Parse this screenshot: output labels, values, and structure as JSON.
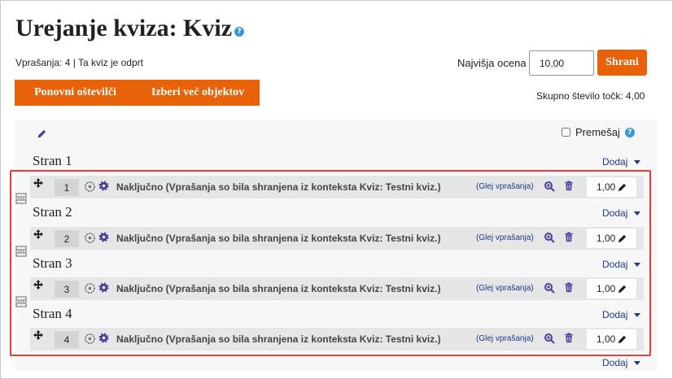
{
  "header": {
    "title": "Urejanje kviza: Kviz",
    "info": "Vprašanja: 4 | Ta kviz je odprt"
  },
  "grade": {
    "label": "Najvišja ocena",
    "value": "10,00",
    "save_label": "Shrani",
    "total_label": "Skupno število točk: 4,00"
  },
  "actions": {
    "repaginate": "Ponovni oštevilči",
    "select_multiple": "Izberi več objektov"
  },
  "shuffle_label": "Premešaj",
  "add_label": "Dodaj",
  "pages": [
    {
      "label": "Stran 1",
      "slot": {
        "number": "1",
        "text": "Naključno (Vprašanja so bila shranjena iz konteksta Kviz: Testni kviz.)",
        "preview": "(Glej vprašanja)",
        "mark": "1,00"
      }
    },
    {
      "label": "Stran 2",
      "slot": {
        "number": "2",
        "text": "Naključno (Vprašanja so bila shranjena iz konteksta Kviz: Testni kviz.)",
        "preview": "(Glej vprašanja)",
        "mark": "1,00"
      }
    },
    {
      "label": "Stran 3",
      "slot": {
        "number": "3",
        "text": "Naključno (Vprašanja so bila shranjena iz konteksta Kviz: Testni kviz.)",
        "preview": "(Glej vprašanja)",
        "mark": "1,00"
      }
    },
    {
      "label": "Stran 4",
      "slot": {
        "number": "4",
        "text": "Naključno (Vprašanja so bila shranjena iz konteksta Kviz: Testni kviz.)",
        "preview": "(Glej vprašanja)",
        "mark": "1,00"
      }
    }
  ],
  "colors": {
    "accent": "#e8620a",
    "link": "#1d3a8a",
    "highlight": "#e53c3c"
  }
}
